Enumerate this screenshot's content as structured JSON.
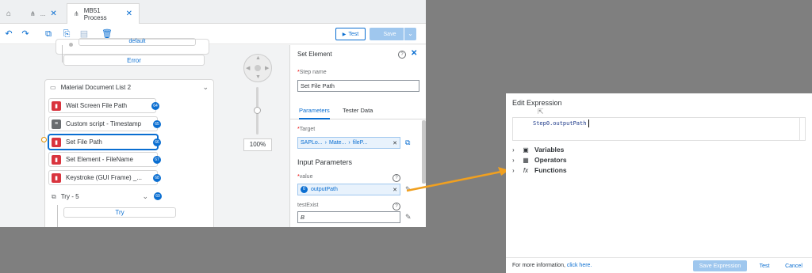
{
  "tabs": {
    "home_icon": "home-icon",
    "tab1": {
      "label": "...",
      "icon": "hierarchy-icon"
    },
    "tab2": {
      "label": "MB51 Process",
      "icon": "hierarchy-icon"
    }
  },
  "toolbar": {
    "test_label": "Test",
    "save_label": "Save"
  },
  "canvas": {
    "default_label": "default",
    "error_label": "Error",
    "group_title": "Material Document List 2",
    "steps": [
      {
        "label": "Wait Screen File Path",
        "badge": "64"
      },
      {
        "label": "Custom script - Timestamp",
        "badge": "65"
      },
      {
        "label": "Set File Path",
        "badge": "66"
      },
      {
        "label": "Set Element - FileName",
        "badge": "67"
      },
      {
        "label": "Keystroke (GUI Frame) _...",
        "badge": "68"
      }
    ],
    "try_title": "Try - 5",
    "try_badge": "69",
    "try_label": "Try",
    "zoom": "100%"
  },
  "panel": {
    "title": "Set Element",
    "step_name_label": "Step name",
    "step_name_value": "Set File Path",
    "tabs": [
      "Parameters",
      "Tester Data"
    ],
    "target_label": "Target",
    "target_tokens": [
      "SAPLo...",
      "Mate...",
      "fileP..."
    ],
    "input_params_title": "Input Parameters",
    "value_label": "value",
    "value_token_index": "0",
    "value_token": "outputPath",
    "testexist_label": "testExist",
    "testexist_value": "B"
  },
  "dialog": {
    "title": "Edit Expression",
    "code": "Step0.outputPath",
    "tree": [
      {
        "label": "Variables",
        "icon": "variables-icon"
      },
      {
        "label": "Operators",
        "icon": "calculator-icon"
      },
      {
        "label": "Functions",
        "icon": "function-icon"
      }
    ],
    "info_text": "For more information,",
    "info_link": "click here.",
    "save_expression_label": "Save Expression",
    "test_label": "Test",
    "cancel_label": "Cancel"
  },
  "colors": {
    "accent": "#0a6ed1",
    "step_red": "#d9343e",
    "arrow": "#f0a020"
  }
}
